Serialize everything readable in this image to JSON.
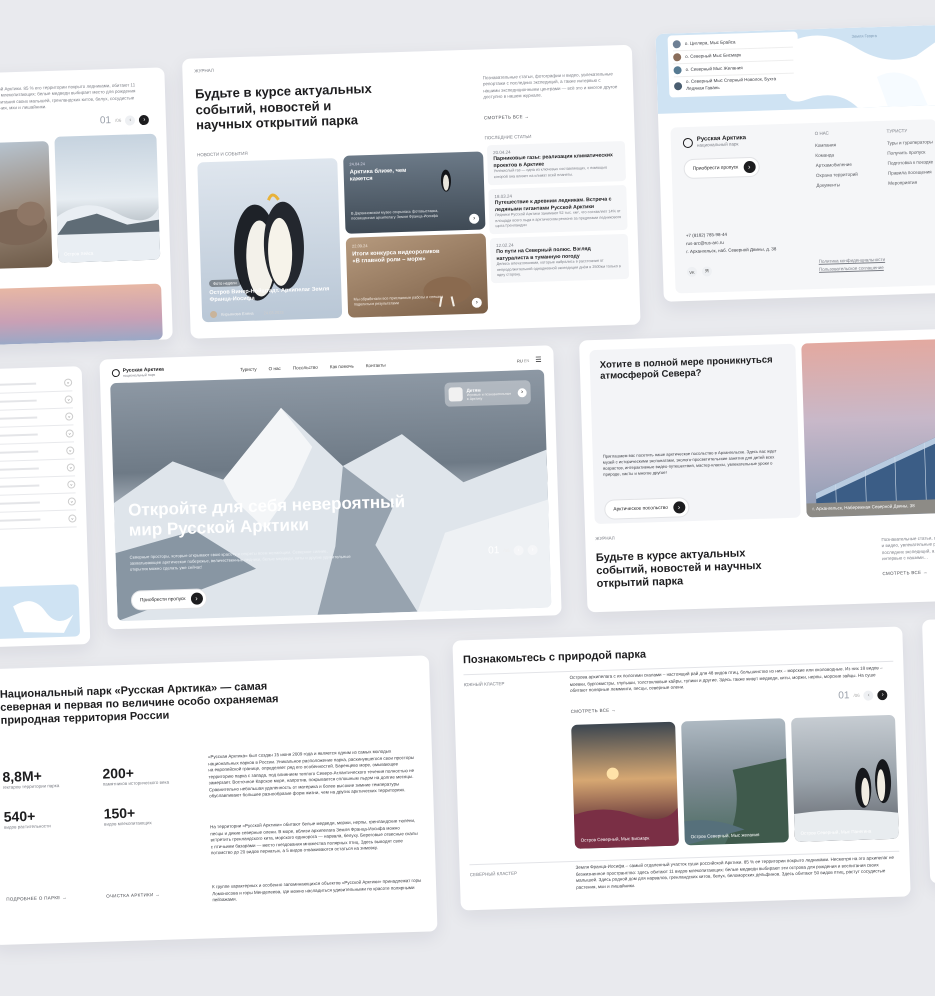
{
  "card1": {
    "text": "…йской Арктики. 85 % его территории покрыто ледниками, обитают 11 видов млекопитающих: белые медведи выбирает место для рождения и воспитания своих малышей, гренландских китов, белух, сосудистые растения, мхи и лишайники.",
    "pager_num": "01",
    "pager_of": "/06",
    "caption": "Остров Хейса"
  },
  "news": {
    "tag": "Журнал",
    "title": "Будьте в курсе актуальных событий, новостей и научных открытий парка",
    "desc": "Познавательные статьи, фотографии и видео, увлекательные репортажи с последних экспедиций, а также интервью с нашими экспедиционными центрами — всё это и многое другое доступно в нашем журнале.",
    "see_all": "Смотреть все",
    "section_news": "Новости и события",
    "section_last": "Последние статьи",
    "feature_badge": "Фото недели",
    "feature_title": "Остров Винер-Нойштадт. Архипелаг Земля Франца-Иосифа",
    "feature_author": "Кирьянова Елена",
    "feature_date": "24.03.2023",
    "mid": [
      {
        "date": "24.04.24",
        "title": "Арктика ближе, чем кажется",
        "text": "В Дарвиновском музее открылась фотовыставка, посвященная архипелагу Земля Франца-Иосифа"
      },
      {
        "date": "22.09.24",
        "title": "Итоги конкурса видеороликов «В главной роли – морж»",
        "text": "Мы обработали все присланные работы и спешим поделиться результатами"
      }
    ],
    "articles": [
      {
        "date": "20.04.24",
        "title": "Парниковые газы: реализация климатических проектов в Арктике",
        "text": "Углекислый газ — одна из ключевых составляющих, с помощью которой она влияет на климат всей планеты."
      },
      {
        "date": "18.03.24",
        "title": "Путешествие к древним ледникам. Встреча с ледяными гигантами Русской Арктики",
        "text": "Ледники Русской Арктики занимают 52 тыс. км², что составляет 14% от площади всего льда в арктическом регионе за пределами ледникового щита Гренландии"
      },
      {
        "date": "12.02.24",
        "title": "По пути на Северный полюс. Взгляд натуралиста в туманную погоду",
        "text": "Делюсь впечатлениями, которые набрались в расстояния от непродолжительной однодневной экспедиции днём в 2500км только в одну сторону."
      }
    ]
  },
  "footer": {
    "map_items": [
      "о. Циглера, Мыс Брайса",
      "о. Северный Мыс Бисмарк",
      "о. Северный Мыс Желания",
      "о. Северный Мыс Спорный Новолок, Бухта Ледяная Гавань"
    ],
    "map_label": "Земля Георга",
    "logo_name": "Русская Арктика",
    "logo_sub": "национальный парк",
    "cta": "Приобрести пропуск",
    "col1_title": "О нас",
    "col1": [
      "Компания",
      "Команда",
      "Артхамобиление",
      "Охрана территорий",
      "Документы"
    ],
    "col2_title": "Туристу",
    "col2": [
      "Туры и туроператоры",
      "Получить пропуск",
      "Подготовка к поездке",
      "Правила посещения",
      "Мероприятия"
    ],
    "phone": "+7 (8182) 785-98-44",
    "email": "rus-arc@rus-arc.ru",
    "address": "г. Архангельск, наб. Северной Двины, д. 38",
    "policy": "Политика конфиденциальности",
    "terms": "Пользовательское соглашение",
    "social1": "VK",
    "social2": "Я"
  },
  "hero": {
    "logo_name": "Русская Арктика",
    "logo_sub": "национальный парк",
    "nav": [
      "Туристу",
      "О нас",
      "Посольство",
      "Как помочь",
      "Контакты"
    ],
    "lang": "RU",
    "lang2": "EN",
    "badge_title": "Детям",
    "badge_text": "Игровые и познавательные в Арктику",
    "headline": "Откройте для себя невероятный мир Русской Арктики",
    "sub": "Северные просторы, которые открывают свою красоту и секреты всем желающим. Северное сияние, захватывающее арктическое побережье, величественные ледники, белые медведи, киты и другие удивительные открытия можно сделать уже сейчас!",
    "cta": "Приобрести пропуск",
    "pager_num": "01",
    "pager_of": "/06"
  },
  "embassy": {
    "title": "Хотите в полной мере проникнуться атмосферой Севера?",
    "text": "Приглашаем вас посетить наше арктическое посольство в Архангельске. Здесь вас ждет музей с историческими экспонатами, эколого-просветительские занятия для детей всех возрастов, интерактивные видео-путешествия, мастер-классы, увлекательные уроки о природе, хасты и многое другое!",
    "cta": "Арктическое посольство",
    "caption": "г. Архангельск, Набережная Северной Двины, 38",
    "tag": "Журнал",
    "title2": "Будьте в курсе актуальных событий, новостей и научных открытий парка",
    "desc2": "Познавательные статьи, фотографии и видео, увлекательные репортажи с последних экспедиций, а также интервью с нашими…",
    "see_all": "Смотреть все"
  },
  "about": {
    "title": "Национальный парк «Русская Арктика» — самая северная и первая по величине особо охраняемая природная территория России",
    "stats": [
      {
        "value": "8,8M+",
        "label": "гектаров территории парка"
      },
      {
        "value": "200+",
        "label": "памятников исторического века"
      },
      {
        "value": "540+",
        "label": "видов растительности"
      },
      {
        "value": "150+",
        "label": "видов млекопитающих"
      }
    ],
    "p1": "«Русская Арктика» был создан 15 июня 2009 года и является одним из самых молодых национальных парков в России. Уникальное расположение парка, раскинувшегося свои просторы на европейской границе, определяет ряд его особенностей. Баренцево море, омывающее территорию парка с запада, под влиянием теплого Северо-Атлантического течения полностью не замерзает. Восточное Карское море, напротив, покрывается сплошным льдом на долгие месяцы. Сравнительно небольшая удаленность от материка и более высокие зимние температуры обуславливают большее разнообразие форм жизни, чем на других арктических территориях.",
    "p2": "На территории «Русской Арктики» обитают белые медведи, моржи, нерпы, гренландские тюлени, песцы и дикие северные олени. В море, вблизи архипелага Земля Франца-Иосифа можно встретить гренландского кита, морского единорога — нарвала, белуху. Береговые отвесные скалы с птичьими базарами — место гнездования множества полярных птиц. Здесь выводят свое потомство до 20 видов пернатых, а 5 видов отваживаются остаться на зимовку.",
    "p3": "К группе характерных и особенно запоминающихся объектов «Русской Арктики» принадлежат горы Ломоносова и горы Менделеева, где можно насладиться удивительными по красоте полярными пейзажами.",
    "link1": "Подробнее о парке",
    "link2": "Очистка Арктики"
  },
  "nature": {
    "title": "Познакомьтесь с природой парка",
    "region1": "Южный кластер",
    "text1": "Острова архипелага с их пологими скалами – настоящий рай для 48 видов птиц, большинство из них – морские или околоводные. Из них 18 видов – моевки, бургомистры, глупыши, толстоклювые кайры, тупики и другие. Здесь также живут медведи, киты, моржи, нерпы, морские зайцы. На суше обитают полярные лемминги, песцы, северные олени.",
    "see_all": "Смотреть все",
    "pager_num": "01",
    "pager_of": "/06",
    "captions": [
      "Остров Северный, Мыс Бисмарк",
      "Остров Северный, Мыс желания",
      "Остров Северный, Мыс Панегина"
    ],
    "region2": "Северный кластер",
    "text2": "Земля Франца-Иосифа – самый отдаленный участок суши российской Арктики. 85 % ее территории покрыто ледниками. Несмотря на это архипелаг не безжизненное пространство: здесь обитают 11 видов млекопитающих: белые медведи выбирают эти острова для рождения и воспитания своих малышей. Здесь родной дом для нарвалов, гренландских китов, белух, беломорских дельфинов. Здесь обитают 50 видов птиц, растут сосудистые растения, мхи и лишайники."
  },
  "faq": {
    "rows": 9
  },
  "colors": {
    "accent": "#1d1d1f",
    "bg": "#e9eaee",
    "ice": "#cfe3f3"
  }
}
